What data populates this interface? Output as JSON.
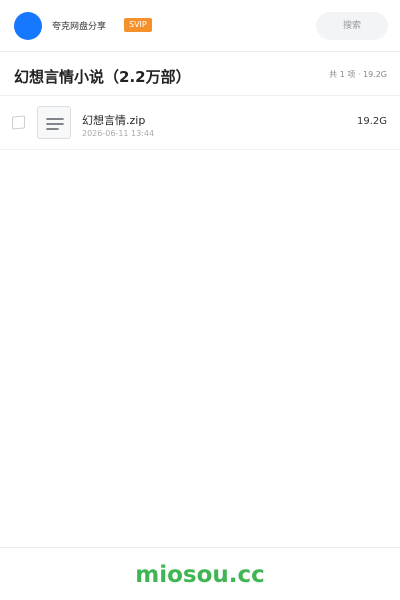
{
  "header": {
    "owner_name": "夸克网盘分享",
    "badge": "SVIP",
    "search_placeholder": "搜索",
    "avatar_color": "#1677ff",
    "badge_color": "#f5912a"
  },
  "folder": {
    "title": "幻想言情小说（2.2万部）",
    "summary": "共 1 项 · 19.2G"
  },
  "files": [
    {
      "name": "幻想言情.zip",
      "date": "2026-06-11 13:44",
      "size": "19.2G",
      "icon": "document-icon"
    }
  ],
  "footer": {
    "brand": "miosou.cc",
    "brand_color": "#3fb553"
  }
}
